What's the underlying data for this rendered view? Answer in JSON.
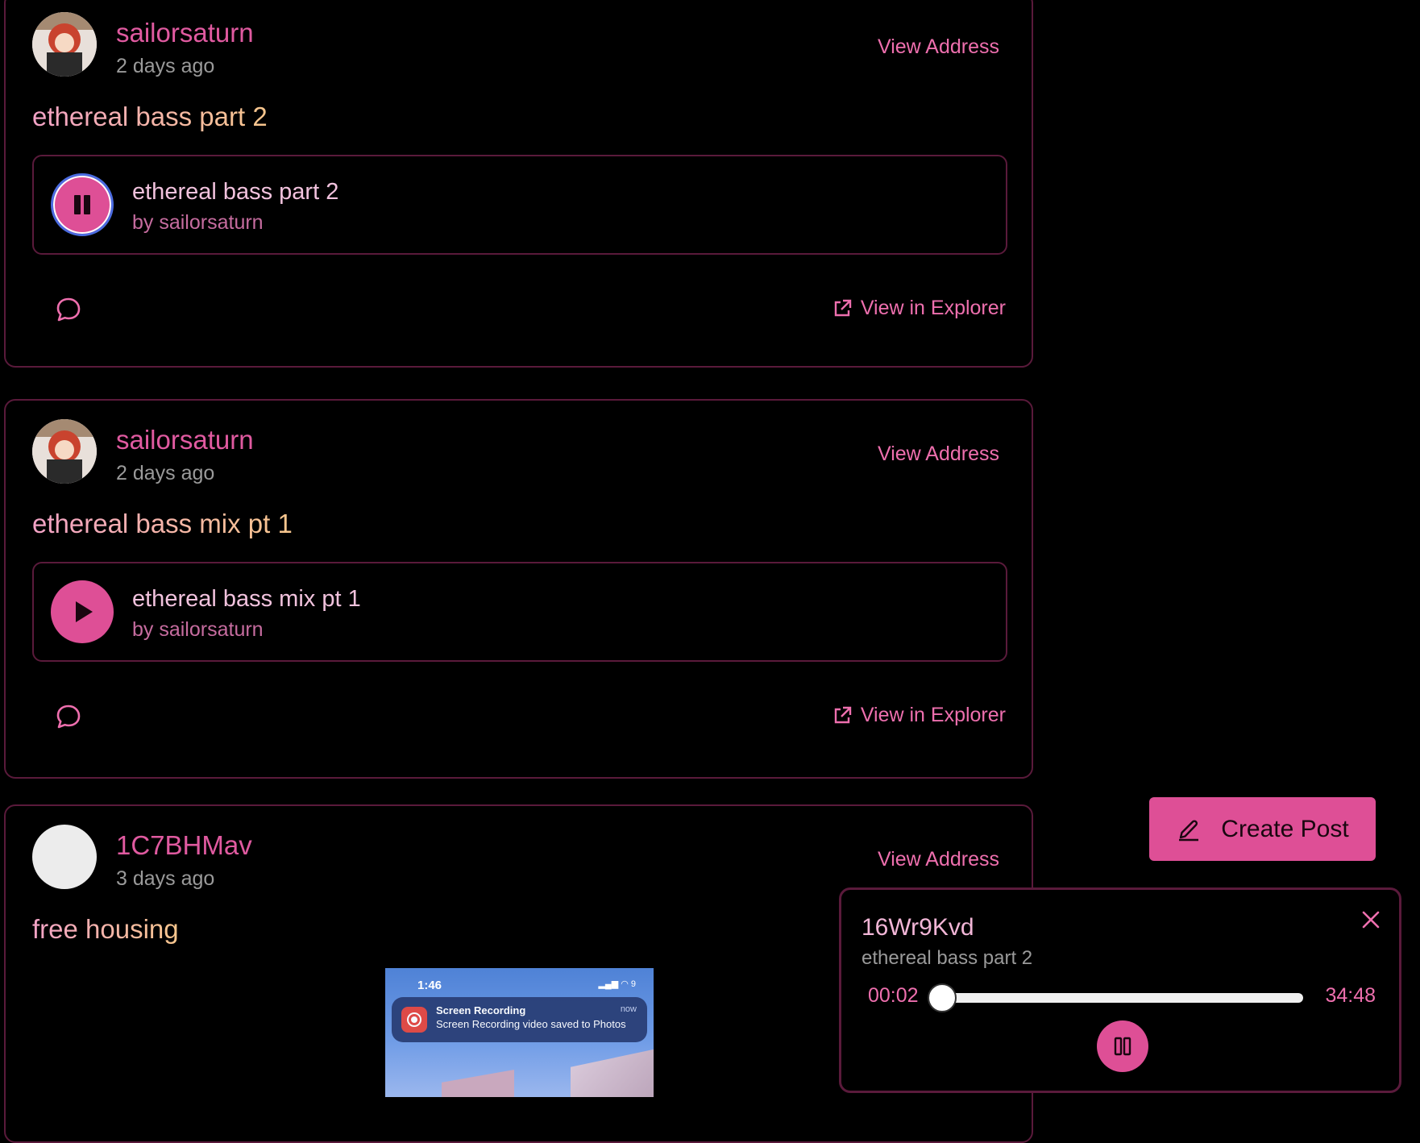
{
  "posts": [
    {
      "username": "sailorsaturn",
      "time_ago": "2 days ago",
      "view_address_label": "View Address",
      "title": "ethereal bass part 2",
      "track": {
        "title": "ethereal bass part 2",
        "artist": "by sailorsaturn",
        "state": "playing"
      },
      "explorer_label": "View in Explorer"
    },
    {
      "username": "sailorsaturn",
      "time_ago": "2 days ago",
      "view_address_label": "View Address",
      "title": "ethereal bass mix pt 1",
      "track": {
        "title": "ethereal bass mix pt 1",
        "artist": "by sailorsaturn",
        "state": "paused"
      },
      "explorer_label": "View in Explorer"
    },
    {
      "username": "1C7BHMav",
      "time_ago": "3 days ago",
      "view_address_label": "View Address",
      "title": "free housing",
      "image": {
        "status_time": "1:46",
        "status_indicators": "9",
        "notification_title": "Screen Recording",
        "notification_time": "now",
        "notification_body": "Screen Recording video saved to Photos"
      }
    }
  ],
  "create_post": {
    "label": "Create Post",
    "icon": "pencil-icon"
  },
  "player": {
    "title": "16Wr9Kvd",
    "subtitle": "ethereal bass part 2",
    "current_time": "00:02",
    "total_time": "34:48",
    "progress": 0.001,
    "state": "playing"
  },
  "colors": {
    "accent": "#de4f96",
    "accent_text": "#ee6fae",
    "border": "#5a1a3b",
    "background": "#000000"
  }
}
